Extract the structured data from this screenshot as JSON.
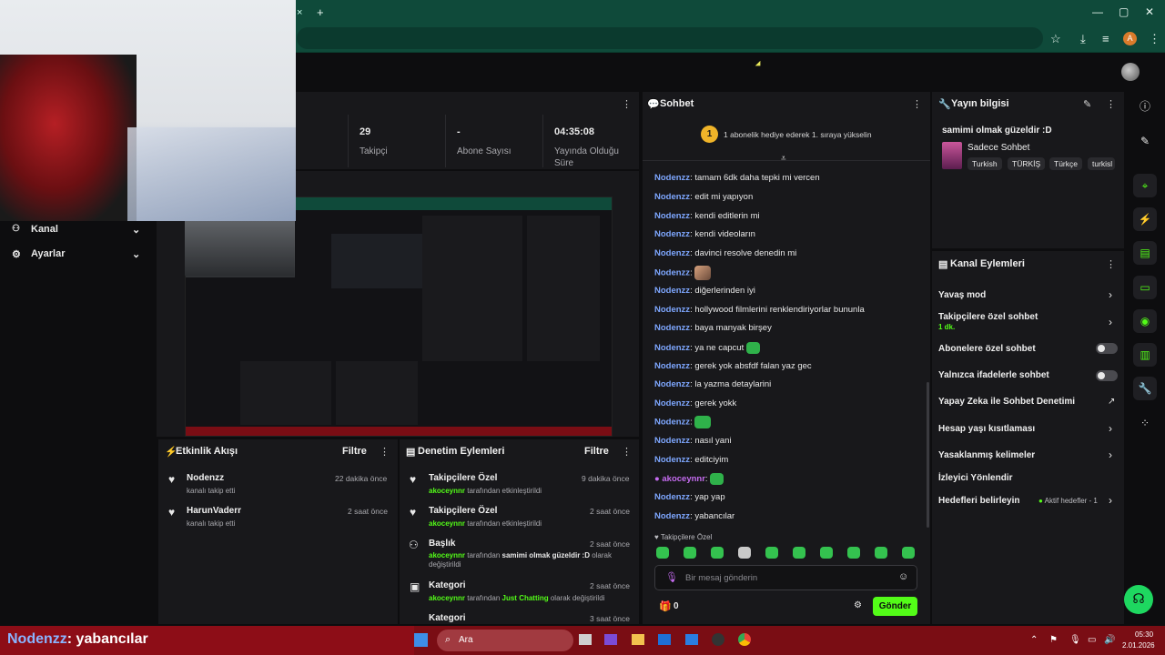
{
  "browser": {
    "new_tab_glyph": "+",
    "close_tab_glyph": "×",
    "window": {
      "minimize": "—",
      "maximize": "▢",
      "close": "✕"
    },
    "profile_initial": "A"
  },
  "stats": [
    {
      "value": "29",
      "label": "Takipçi"
    },
    {
      "value": "-",
      "label": "Abone Sayısı"
    },
    {
      "value": "04:35:08",
      "label": "Yayında Olduğu Süre"
    }
  ],
  "left_menu": [
    {
      "label": "Kanal",
      "icon": "people-icon"
    },
    {
      "label": "Ayarlar",
      "icon": "gear-icon"
    }
  ],
  "chat": {
    "title": "Sohbet",
    "gift_badge": "1",
    "gift_text": "1 abonelik hediye ederek 1. sıraya yükselin",
    "messages": [
      {
        "user": "Nodenzz",
        "text": ": tamam 6dk daha tepki mi vercen"
      },
      {
        "user": "Nodenzz",
        "text": ": edit mi yapıyon"
      },
      {
        "user": "Nodenzz",
        "text": ": kendi editlerin mi"
      },
      {
        "user": "Nodenzz",
        "text": ": kendi videoların"
      },
      {
        "user": "Nodenzz",
        "text": ": davinci resolve denedin mi"
      },
      {
        "user": "Nodenzz",
        "text": ":"
      },
      {
        "user": "Nodenzz",
        "text": ": diğerlerinden iyi"
      },
      {
        "user": "Nodenzz",
        "text": ": hollywood filmlerini renklendiriyorlar bununla"
      },
      {
        "user": "Nodenzz",
        "text": ": baya manyak birşey"
      },
      {
        "user": "Nodenzz",
        "text": ": ya ne capcut"
      },
      {
        "user": "Nodenzz",
        "text": ": gerek yok absfdf falan yaz gec"
      },
      {
        "user": "Nodenzz",
        "text": ": la yazma detaylarini"
      },
      {
        "user": "Nodenzz",
        "text": ": gerek yokk"
      },
      {
        "user": "Nodenzz",
        "text": ":"
      },
      {
        "user": "Nodenzz",
        "text": ": nasıl yani"
      },
      {
        "user": "Nodenzz",
        "text": ": editciyim"
      },
      {
        "user": "akoceynnr",
        "text": ":"
      },
      {
        "user": "Nodenzz",
        "text": ": yap yap"
      },
      {
        "user": "Nodenzz",
        "text": ": yabancılar"
      }
    ],
    "emote_label": "Takipçilere Özel",
    "input_placeholder": "Bir mesaj gönderin",
    "points": "0",
    "send": "Gönder"
  },
  "stream_info": {
    "title": "Yayın bilgisi",
    "stream_title": "samimi olmak güzeldir :D",
    "category": "Sadece Sohbet",
    "tags": [
      "Turkish",
      "TÜRKİŞ",
      "Türkçe",
      "turkisl"
    ]
  },
  "channel_actions": {
    "title": "Kanal Eylemleri",
    "items": [
      {
        "label": "Yavaş mod"
      },
      {
        "label": "Takipçilere özel sohbet",
        "sub": "1 dk."
      },
      {
        "label": "Abonelere özel sohbet"
      },
      {
        "label": "Yalnızca ifadelerle sohbet"
      },
      {
        "label": "Yapay Zeka ile Sohbet Denetimi"
      },
      {
        "label": "Hesap yaşı kısıtlaması"
      },
      {
        "label": "Yasaklanmış kelimeler"
      },
      {
        "label": "İzleyici Yönlendir"
      },
      {
        "label": "Hedefleri belirleyin",
        "status": "Aktif hedefler - 1"
      }
    ]
  },
  "activity": {
    "title": "Etkinlik Akışı",
    "filter": "Filtre",
    "items": [
      {
        "name": "Nodenzz",
        "desc": "kanalı takip etti",
        "time": "22 dakika önce"
      },
      {
        "name": "HarunVaderr",
        "desc": "kanalı takip etti",
        "time": "2 saat önce"
      }
    ]
  },
  "moderation": {
    "title": "Denetim Eylemleri",
    "filter": "Filtre",
    "items": [
      {
        "title": "Takipçilere Özel",
        "actor": "akoceynnr",
        "mid": " tarafından etkinleştirildi",
        "value": "",
        "tail": "",
        "time": "9 dakika önce"
      },
      {
        "title": "Takipçilere Özel",
        "actor": "akoceynnr",
        "mid": " tarafından etkinleştirildi",
        "value": "",
        "tail": "",
        "time": "2 saat önce"
      },
      {
        "title": "Başlık",
        "actor": "akoceynnr",
        "mid": " tarafından ",
        "value": "samimi olmak güzeldir :D",
        "tail": " olarak değiştirildi",
        "time": "2 saat önce"
      },
      {
        "title": "Kategori",
        "actor": "akoceynnr",
        "mid": " tarafından ",
        "value": "Just Chatting",
        "tail": " olarak değiştirildi",
        "time": "2 saat önce"
      },
      {
        "title": "Kategori",
        "actor": "",
        "mid": "",
        "value": "",
        "tail": "",
        "time": "3 saat önce"
      }
    ]
  },
  "overlay": {
    "user": "Nodenzz",
    "text": ": yabancılar"
  },
  "taskbar": {
    "search": "Ara",
    "time": "05:30",
    "date": "2.01.2026"
  },
  "colors": {
    "accent": "#53fc18",
    "chrome": "#0f4a3a",
    "taskbar": "#7a0d14"
  }
}
